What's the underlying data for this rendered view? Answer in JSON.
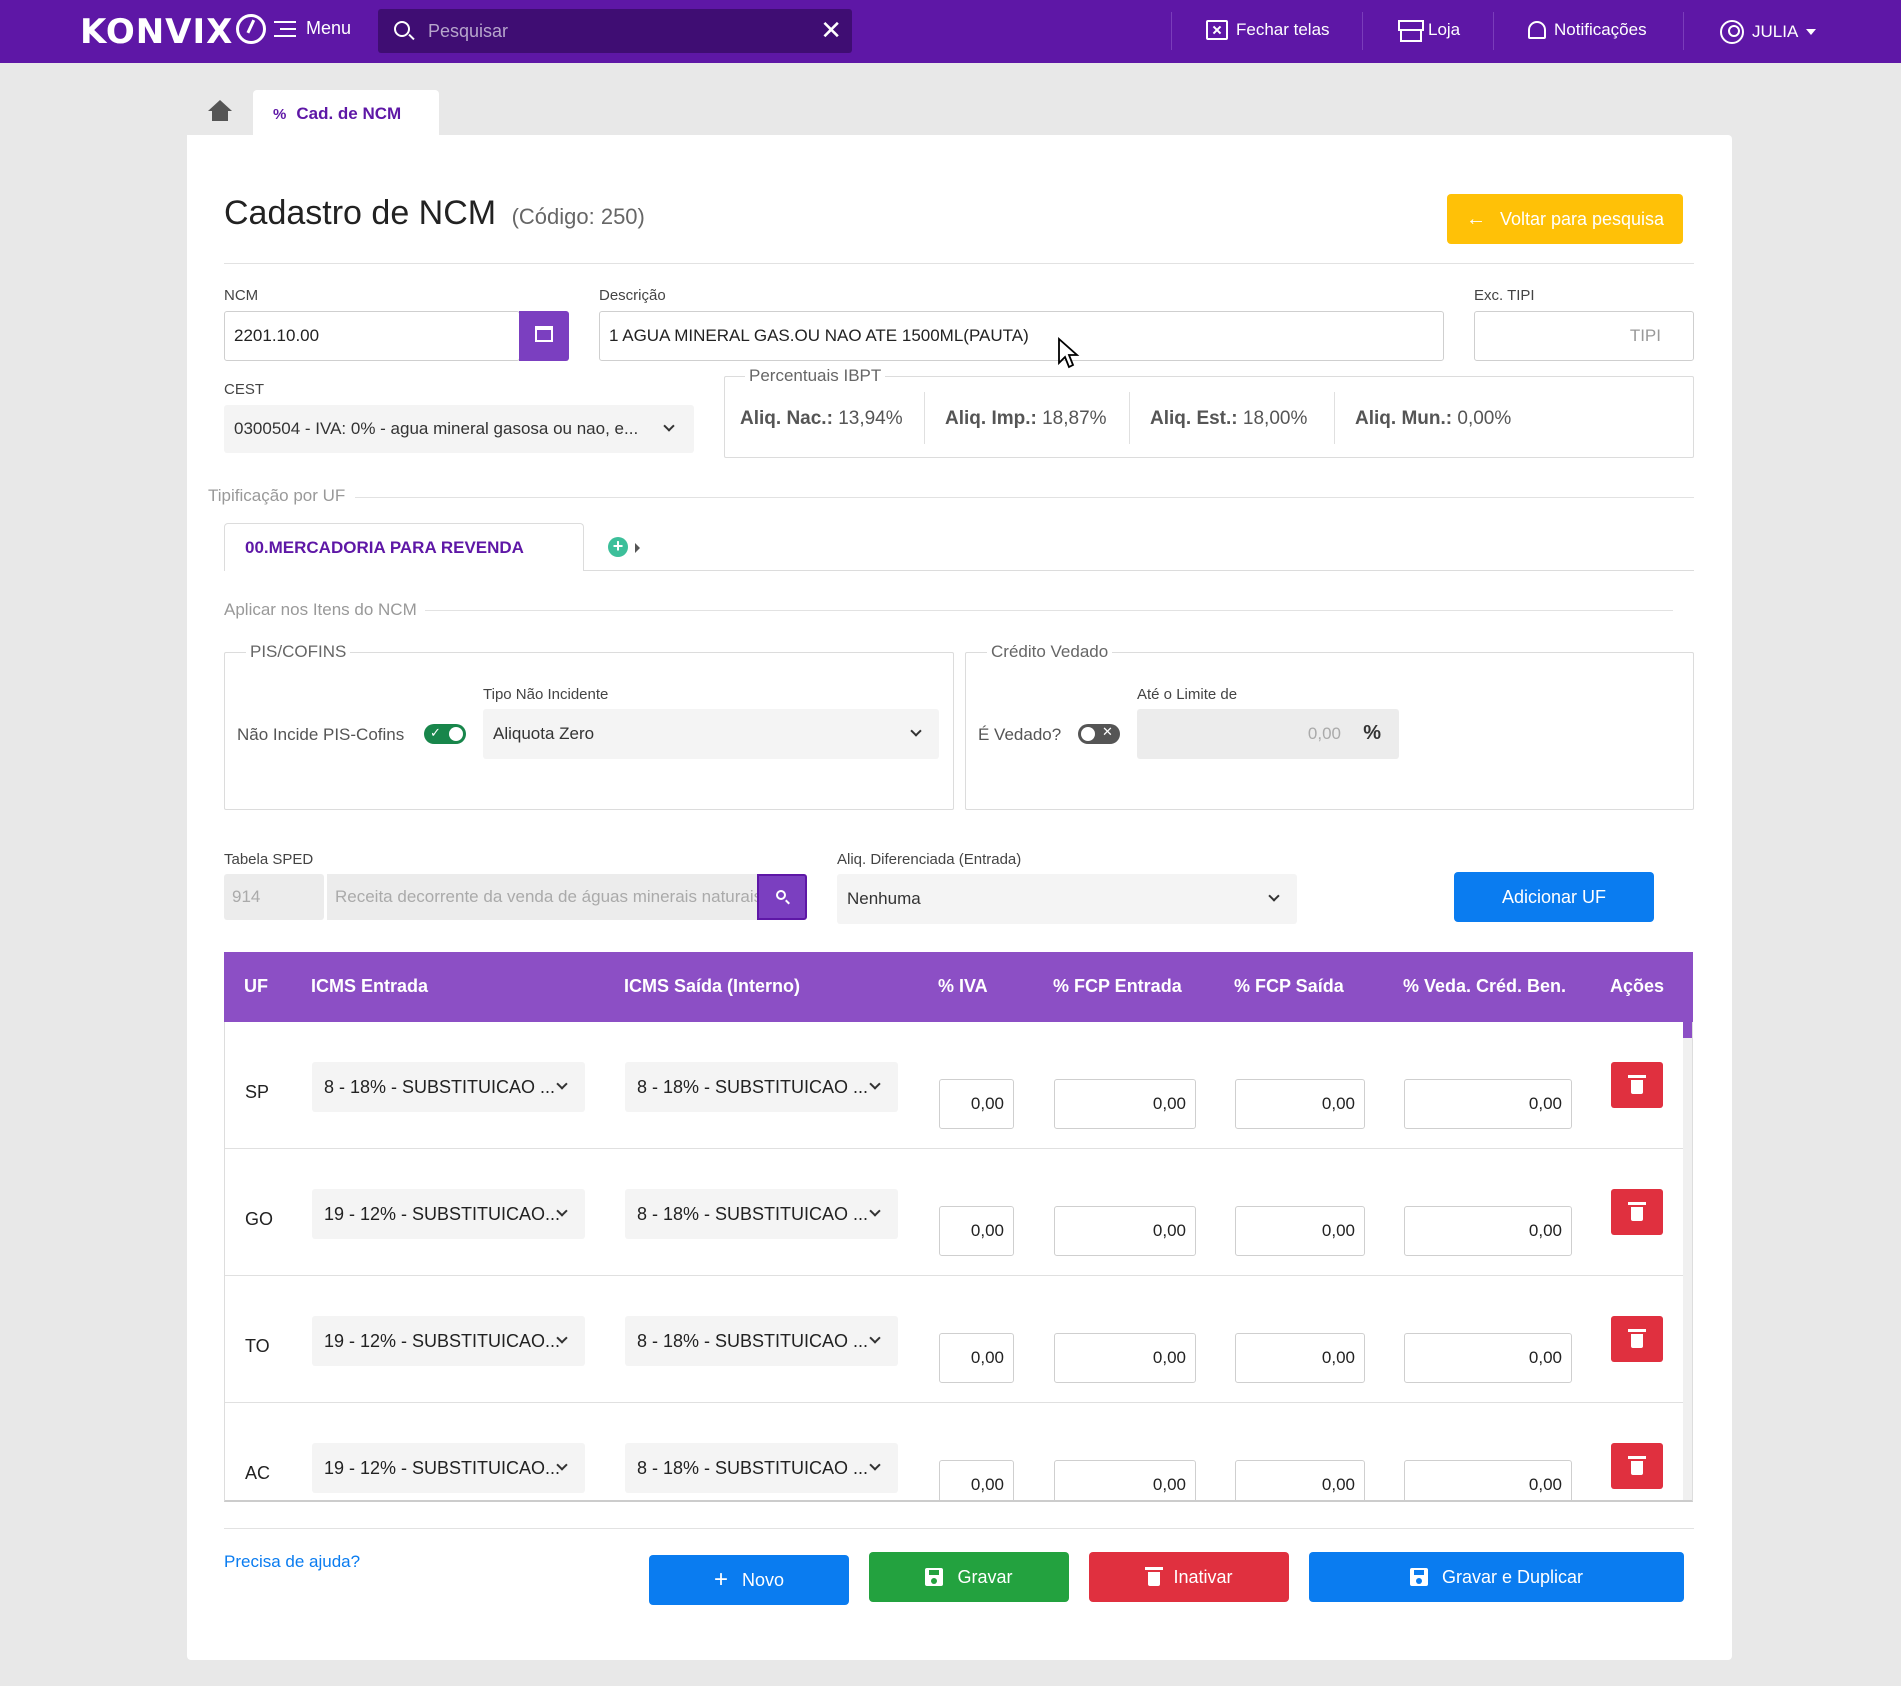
{
  "topbar": {
    "logo": "KONVIX",
    "menu_label": "Menu",
    "search_placeholder": "Pesquisar",
    "close_screens": "Fechar telas",
    "store": "Loja",
    "notifications": "Notificações",
    "user": "JULIA"
  },
  "tabs": {
    "current": "Cad. de NCM"
  },
  "page": {
    "title": "Cadastro de NCM",
    "code": "(Código: 250)",
    "back_button": "Voltar para pesquisa"
  },
  "form": {
    "ncm_label": "NCM",
    "ncm_value": "2201.10.00",
    "description_label": "Descrição",
    "description_value": "1 AGUA MINERAL GAS.OU NAO ATE 1500ML(PAUTA)",
    "exc_tipi_label": "Exc. TIPI",
    "exc_tipi_placeholder": "TIPI",
    "cest_label": "CEST",
    "cest_value": "0300504 - IVA: 0% - agua mineral gasosa ou nao, e..."
  },
  "ibpt": {
    "legend": "Percentuais IBPT",
    "nac_label": "Aliq. Nac.:",
    "nac_value": "13,94%",
    "imp_label": "Aliq. Imp.:",
    "imp_value": "18,87%",
    "est_label": "Aliq. Est.:",
    "est_value": "18,00%",
    "mun_label": "Aliq. Mun.:",
    "mun_value": "0,00%"
  },
  "tipificacao": {
    "title": "Tipificação por UF",
    "tab": "00.MERCADORIA PARA REVENDA"
  },
  "aplicar": {
    "title": "Aplicar nos Itens do NCM",
    "pis_legend": "PIS/COFINS",
    "nao_incide_label": "Não Incide PIS-Cofins",
    "nao_incide_on": true,
    "tipo_label": "Tipo Não Incidente",
    "tipo_value": "Aliquota Zero",
    "credito_legend": "Crédito Vedado",
    "vedado_label": "É Vedado?",
    "vedado_on": false,
    "limite_label": "Até o Limite de",
    "limite_value": "0,00",
    "limite_unit": "%"
  },
  "sped": {
    "label": "Tabela SPED",
    "code": "914",
    "placeholder": "Receita decorrente da venda de águas minerais naturais",
    "aliq_label": "Aliq. Diferenciada (Entrada)",
    "aliq_value": "Nenhuma",
    "add_uf_button": "Adicionar UF"
  },
  "table": {
    "headers": [
      "UF",
      "ICMS Entrada",
      "ICMS Saída (Interno)",
      "% IVA",
      "% FCP Entrada",
      "% FCP Saída",
      "% Veda. Créd. Ben.",
      "Ações"
    ],
    "rows": [
      {
        "uf": "SP",
        "icms_entrada": "8 - 18% - SUBSTITUICAO ...",
        "icms_saida": "8 - 18% - SUBSTITUICAO ...",
        "iva": "0,00",
        "fcp_entrada": "0,00",
        "fcp_saida": "0,00",
        "veda": "0,00"
      },
      {
        "uf": "GO",
        "icms_entrada": "19 - 12% - SUBSTITUICAO...",
        "icms_saida": "8 - 18% - SUBSTITUICAO ...",
        "iva": "0,00",
        "fcp_entrada": "0,00",
        "fcp_saida": "0,00",
        "veda": "0,00"
      },
      {
        "uf": "TO",
        "icms_entrada": "19 - 12% - SUBSTITUICAO...",
        "icms_saida": "8 - 18% - SUBSTITUICAO ...",
        "iva": "0,00",
        "fcp_entrada": "0,00",
        "fcp_saida": "0,00",
        "veda": "0,00"
      },
      {
        "uf": "AC",
        "icms_entrada": "19 - 12% - SUBSTITUICAO...",
        "icms_saida": "8 - 18% - SUBSTITUICAO ...",
        "iva": "0,00",
        "fcp_entrada": "0,00",
        "fcp_saida": "0,00",
        "veda": "0,00"
      }
    ]
  },
  "footer": {
    "help": "Precisa de ajuda?",
    "new": "Novo",
    "save": "Gravar",
    "deactivate": "Inativar",
    "save_duplicate": "Gravar e Duplicar"
  },
  "colors": {
    "brand": "#5e17a6",
    "table_header": "#8c4fc5",
    "warning": "#ffc107",
    "primary": "#0a7cf0",
    "success": "#23a23f",
    "danger": "#e0303f"
  }
}
